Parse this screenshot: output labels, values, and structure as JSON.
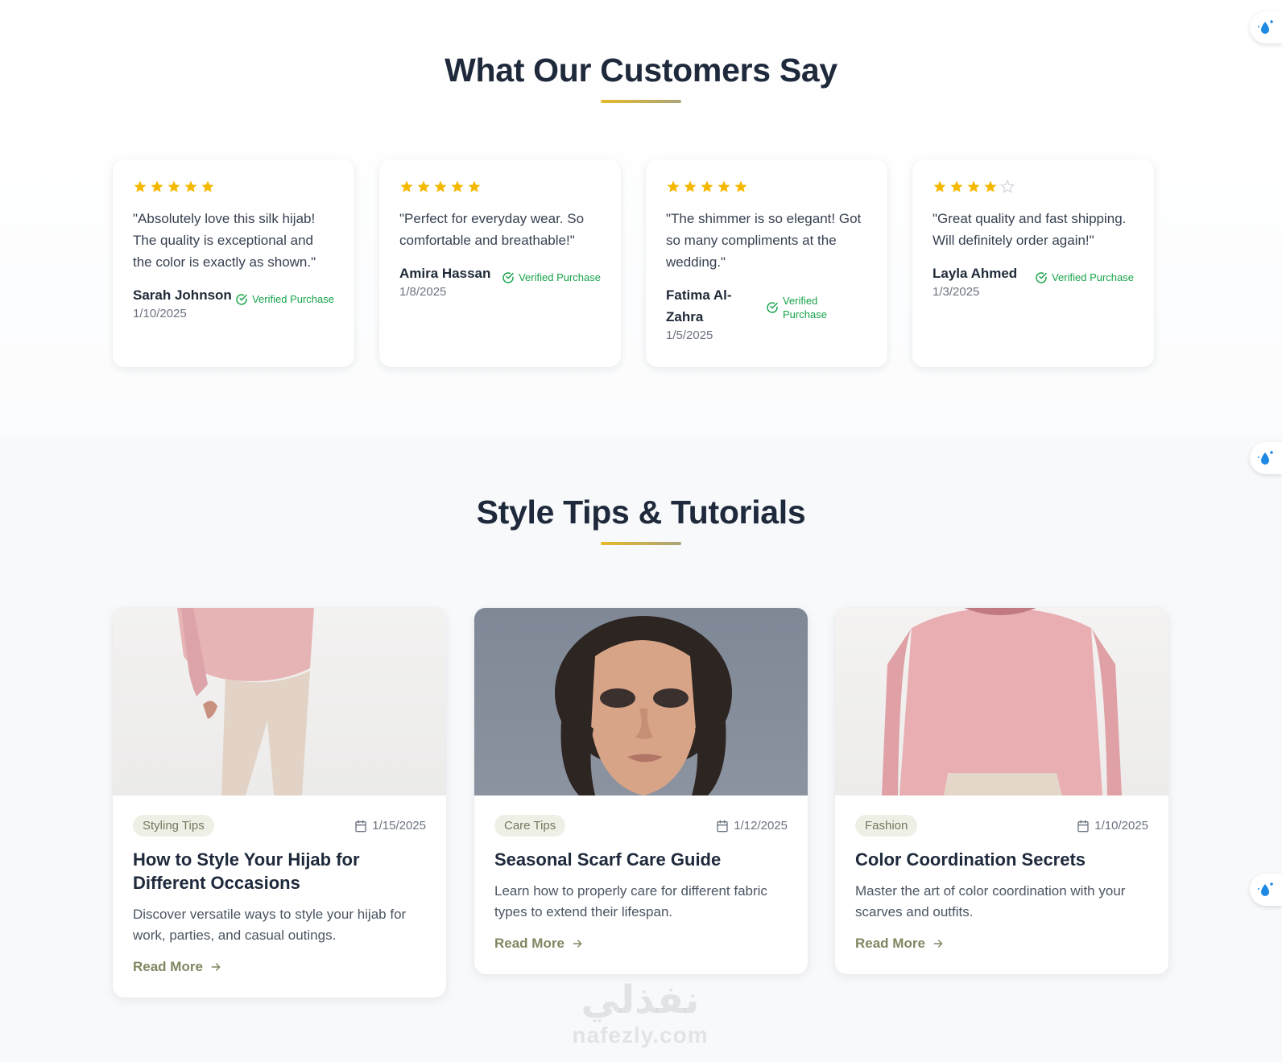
{
  "reviews_section": {
    "title": "What Our Customers Say",
    "star_color": "#f5b800",
    "empty_star_color": "#d1d5db",
    "reviews": [
      {
        "rating": 5,
        "quote": "\"Absolutely love this silk hijab! The quality is exceptional and the color is exactly as shown.\"",
        "name": "Sarah Johnson",
        "date": "1/10/2025",
        "verified": "Verified Purchase"
      },
      {
        "rating": 5,
        "quote": "\"Perfect for everyday wear. So comfortable and breathable!\"",
        "name": "Amira Hassan",
        "date": "1/8/2025",
        "verified": "Verified Purchase"
      },
      {
        "rating": 5,
        "quote": "\"The shimmer is so elegant! Got so many compliments at the wedding.\"",
        "name": "Fatima Al-Zahra",
        "date": "1/5/2025",
        "verified": "Verified Purchase"
      },
      {
        "rating": 4,
        "quote": "\"Great quality and fast shipping. Will definitely order again!\"",
        "name": "Layla Ahmed",
        "date": "1/3/2025",
        "verified": "Verified Purchase"
      }
    ]
  },
  "tips_section": {
    "title": "Style Tips & Tutorials",
    "posts": [
      {
        "category": "Styling Tips",
        "date": "1/15/2025",
        "title": "How to Style Your Hijab for Different Occasions",
        "excerpt": "Discover versatile ways to style your hijab for work, parties, and casual outings.",
        "cta": "Read More",
        "image": "pink-sweater-beige-pants"
      },
      {
        "category": "Care Tips",
        "date": "1/12/2025",
        "title": "Seasonal Scarf Care Guide",
        "excerpt": "Learn how to properly care for different fabric types to extend their lifespan.",
        "cta": "Read More",
        "image": "woman-portrait"
      },
      {
        "category": "Fashion",
        "date": "1/10/2025",
        "title": "Color Coordination Secrets",
        "excerpt": "Master the art of color coordination with your scarves and outfits.",
        "cta": "Read More",
        "image": "pink-sweater"
      }
    ]
  },
  "watermark": {
    "arabic": "نفذلي",
    "latin": "nafezly.com"
  },
  "colors": {
    "accent": "#818661",
    "verified": "#16a34a",
    "heading": "#1e293b"
  }
}
